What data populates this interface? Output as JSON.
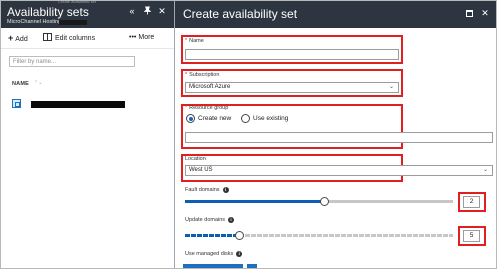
{
  "left_blade": {
    "breadcrumb_hint": "Create availability set",
    "title": "Availability sets",
    "subtitle": "MicroChannel Hosting - ",
    "header_icons": [
      "double-chevron-left-icon",
      "pin-icon",
      "close-icon"
    ],
    "toolbar": {
      "add_label": "Add",
      "edit_columns_label": "Edit columns",
      "more_label": "More"
    },
    "filter_placeholder": "Filter by name...",
    "column_name": "NAME",
    "rows": [
      {
        "name": ""
      }
    ]
  },
  "right_blade": {
    "title": "Create availability set",
    "name": {
      "label": "Name",
      "value": ""
    },
    "subscription": {
      "label": "Subscription",
      "value": "Microsoft Azure"
    },
    "resource_group": {
      "label": "Resource group",
      "option_create": "Create new",
      "option_existing": "Use existing",
      "selected": "Create new",
      "value": ""
    },
    "location": {
      "label": "Location",
      "value": "West US"
    },
    "fault_domains": {
      "label": "Fault domains",
      "value": "2",
      "fraction": 0.52
    },
    "update_domains": {
      "label": "Update domains",
      "value": "5",
      "fraction": 0.2
    },
    "managed_disks": {
      "label": "Use managed disks"
    }
  },
  "colors": {
    "header_bg": "#2d3640",
    "accent": "#0c5fb0",
    "highlight_box": "#e02020"
  }
}
